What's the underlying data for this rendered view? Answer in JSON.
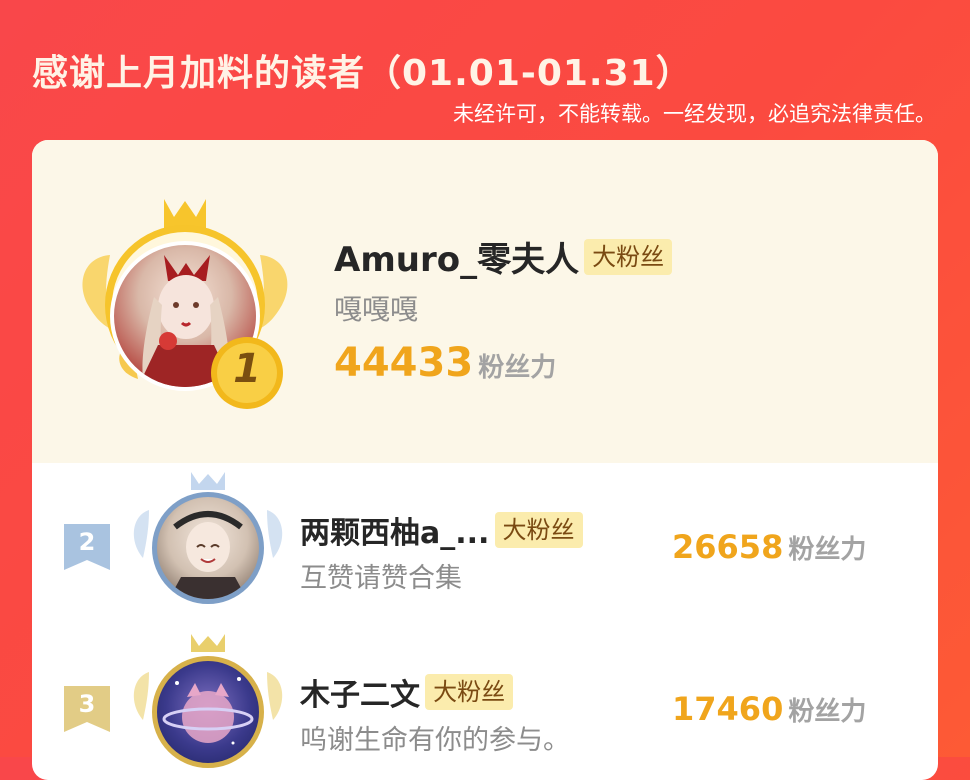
{
  "header": {
    "title": "感谢上月加料的读者（01.01-01.31）",
    "notice": "未经许可，不能转载。一经发现，必追究法律责任。"
  },
  "readers": [
    {
      "rank": "1",
      "name": "Amuro_零夫人",
      "badge": "大粉丝",
      "signature": "嘎嘎嘎",
      "fans": "44433",
      "fans_unit": "粉丝力",
      "frame": "gold",
      "ring": "#f4c21f"
    },
    {
      "rank": "2",
      "name": "两颗西柚a_...",
      "badge": "大粉丝",
      "signature": "互赞请赞合集",
      "fans": "26658",
      "fans_unit": "粉丝力",
      "frame": "silver",
      "ring": "#7e9fc7"
    },
    {
      "rank": "3",
      "name": "木子二文",
      "badge": "大粉丝",
      "signature": "呜谢生命有你的参与。",
      "fans": "17460",
      "fans_unit": "粉丝力",
      "frame": "bronze",
      "ring": "#d7b14a"
    }
  ],
  "colors": {
    "background": "#fb4a40",
    "accent": "#f0a51c",
    "badge_bg": "#fbecad",
    "top_card_bg": "#fcf7e8"
  }
}
